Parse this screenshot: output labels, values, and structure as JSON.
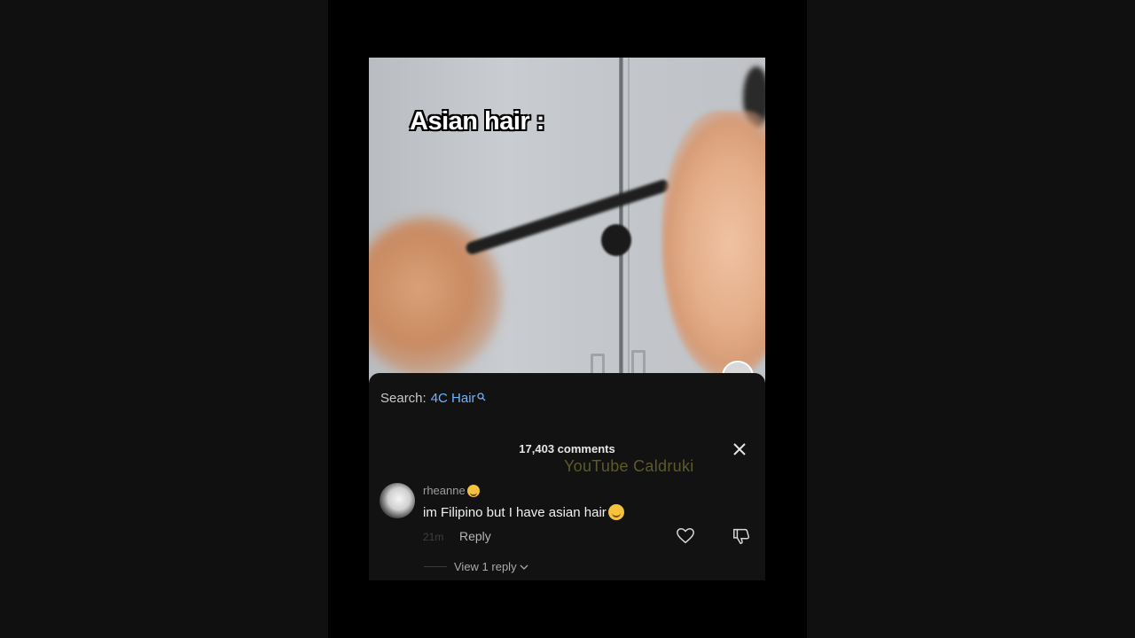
{
  "video": {
    "caption": "Asian hair :"
  },
  "search": {
    "prefix": "Search:",
    "term": "4C Hair",
    "icon": "search-icon"
  },
  "comments": {
    "count_label": "17,403 comments",
    "close_icon": "close-icon",
    "watermark": "YouTube Caldruki",
    "items": [
      {
        "username": "rheanne",
        "text": "im Filipino but I have asian hair",
        "time": "21m",
        "reply_label": "Reply",
        "view_replies_label": "View 1 reply"
      }
    ]
  },
  "colors": {
    "background": "#000000",
    "sheet": "#121212",
    "search_term": "#6fb3ff",
    "watermark": "#5b5a2a"
  }
}
